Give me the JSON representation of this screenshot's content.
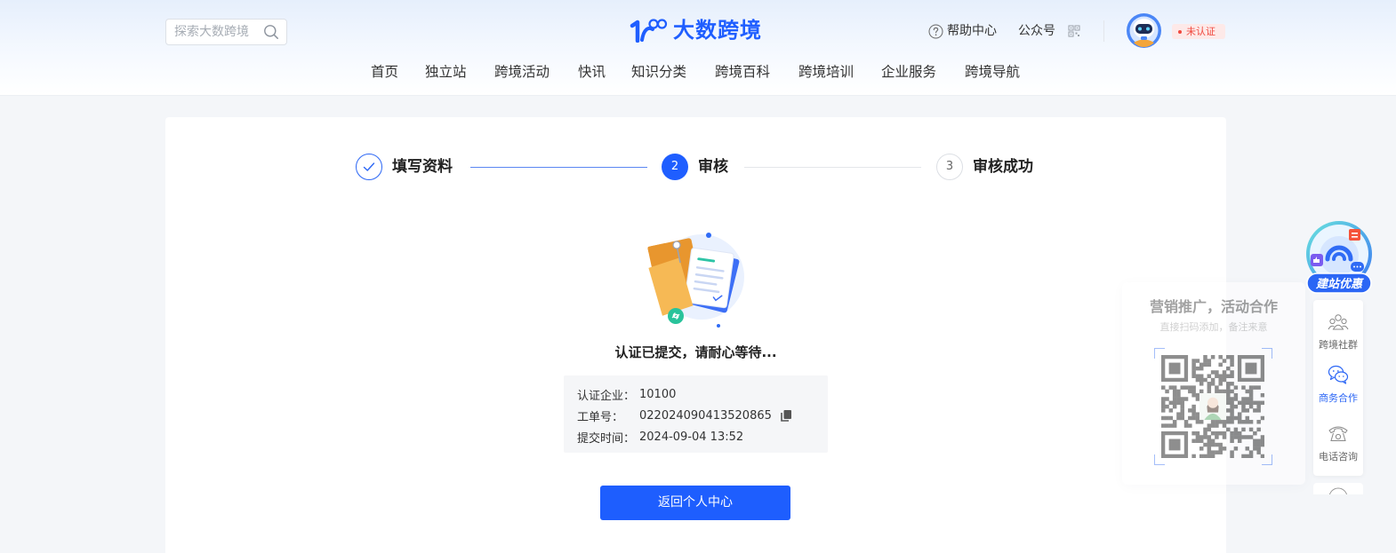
{
  "header": {
    "search": {
      "placeholder": "探索大数跨境",
      "icon": "search-icon"
    },
    "logo": {
      "text": "大数跨境",
      "icon": "logo-icon"
    },
    "help": {
      "label": "帮助中心",
      "icon": "question-circle-icon"
    },
    "official_account": {
      "label": "公众号",
      "icon": "qrcode-icon"
    },
    "avatar": {
      "icon": "robot-avatar-icon"
    },
    "verify_badge": {
      "label": "未认证"
    }
  },
  "nav": {
    "items": [
      "首页",
      "独立站",
      "跨境活动",
      "快讯",
      "知识分类",
      "跨境百科",
      "跨境培训",
      "企业服务",
      "跨境导航"
    ]
  },
  "steps": [
    {
      "label": "填写资料",
      "completed": true,
      "icon": "check-icon"
    },
    {
      "number": "2",
      "label": "审核",
      "current": true
    },
    {
      "number": "3",
      "label": "审核成功",
      "completed": false
    }
  ],
  "result": {
    "illustration": "submitted-documents-illustration",
    "message": "认证已提交，请耐心等待..."
  },
  "info": {
    "rows": [
      {
        "label": "认证企业：",
        "value": "10100"
      },
      {
        "label": "工单号：",
        "value": "022024090413520865",
        "action_icon": "copy-icon"
      },
      {
        "label": "提交时间：",
        "value": "2024-09-04 13:52"
      }
    ]
  },
  "primary_button": {
    "label": "返回个人中心"
  },
  "float_sidebar": {
    "promo": {
      "label": "建站优惠",
      "icon": "site-building-promo-icon"
    },
    "items": [
      {
        "label": "跨境社群",
        "icon": "community-icon",
        "active": false
      },
      {
        "label": "商务合作",
        "icon": "wechat-icon",
        "active": true
      },
      {
        "label": "电话咨询",
        "icon": "phone-icon",
        "active": false
      }
    ],
    "clipped_item_icon": "circle-icon"
  },
  "contact_popup": {
    "title": "营销推广，活动合作",
    "subtitle": "直接扫码添加，备注来意",
    "qr_icon": "qr-code-image"
  },
  "colors": {
    "brand": "#1f5eff",
    "badge_red": "#f0483e",
    "badge_bg": "#fde9e8",
    "page_bg": "#f4f6f9",
    "info_bg": "#f5f6f8",
    "text": "#333333",
    "success_green": "#29c39b",
    "folder_orange": "#f0a33a"
  }
}
